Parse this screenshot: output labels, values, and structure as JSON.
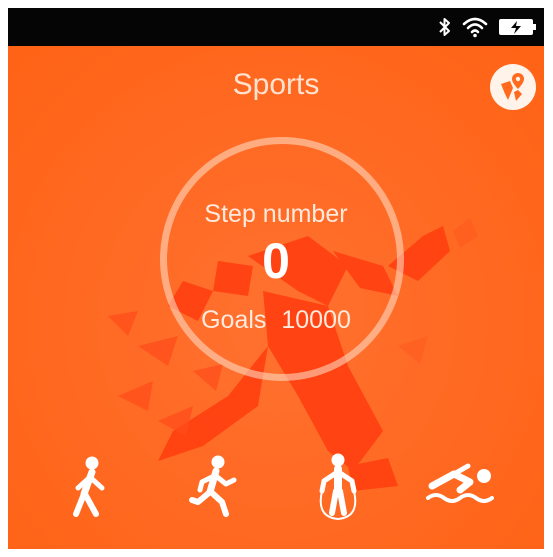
{
  "status_bar": {
    "icons": [
      "bluetooth-icon",
      "wifi-icon",
      "battery-charging-icon"
    ]
  },
  "header": {
    "title": "Sports",
    "action_icon": "location-pin-icon"
  },
  "steps": {
    "label": "Step number",
    "value": "0",
    "goals_label": "Goals",
    "goals_value": "10000"
  },
  "activities": [
    {
      "name": "walk",
      "icon": "walking-icon"
    },
    {
      "name": "run",
      "icon": "running-icon"
    },
    {
      "name": "jump-rope",
      "icon": "jump-rope-icon"
    },
    {
      "name": "swim",
      "icon": "swimming-icon"
    }
  ],
  "colors": {
    "background": "#ff6a1f",
    "accent_light": "#fff3ea",
    "status_bar": "#050505"
  }
}
